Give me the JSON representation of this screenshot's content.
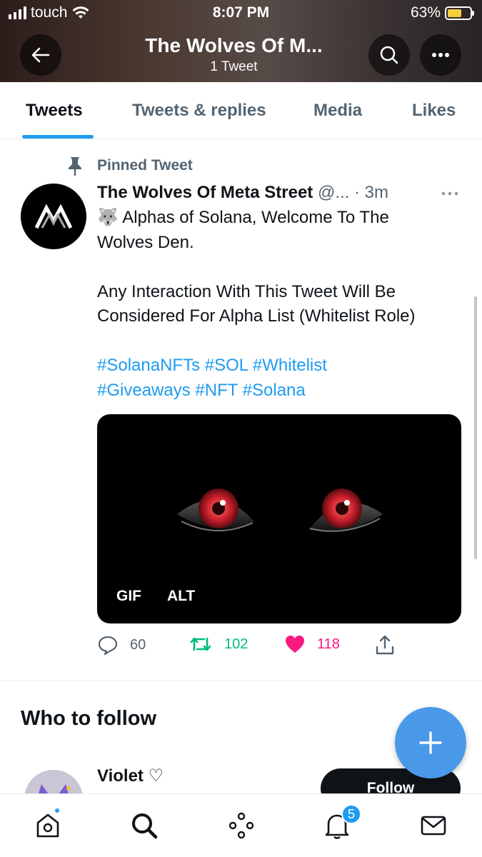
{
  "status_bar": {
    "carrier": "touch",
    "time": "8:07 PM",
    "battery": "63%"
  },
  "header": {
    "title": "The Wolves Of M...",
    "subtitle": "1 Tweet"
  },
  "tabs": [
    {
      "label": "Tweets",
      "active": true
    },
    {
      "label": "Tweets & replies",
      "active": false
    },
    {
      "label": "Media",
      "active": false
    },
    {
      "label": "Likes",
      "active": false
    }
  ],
  "tweet": {
    "pinned_label": "Pinned Tweet",
    "author_name": "The Wolves Of Meta Street",
    "author_handle": "@...",
    "time": "· 3m",
    "text_line1": "🐺 Alphas of Solana, Welcome To The",
    "text_line2": "Wolves Den.",
    "text_line3": "Any Interaction With This Tweet Will Be",
    "text_line4": "Considered For Alpha List (Whitelist Role)",
    "hashtags_line1": "#SolanaNFTs #SOL #Whitelist",
    "hashtags_line2": "#Giveaways #NFT #Solana",
    "media_badge_gif": "GIF",
    "media_badge_alt": "ALT",
    "reply_count": "60",
    "retweet_count": "102",
    "like_count": "118"
  },
  "who_to_follow": {
    "title": "Who to follow",
    "suggestion_name": "Violet ♡",
    "follow_label": "Follow"
  },
  "bottom_nav": {
    "notification_count": "5"
  },
  "colors": {
    "accent": "#1d9bf0",
    "retweet": "#00ba7c",
    "like": "#f91880",
    "fab": "#4a99e9"
  }
}
